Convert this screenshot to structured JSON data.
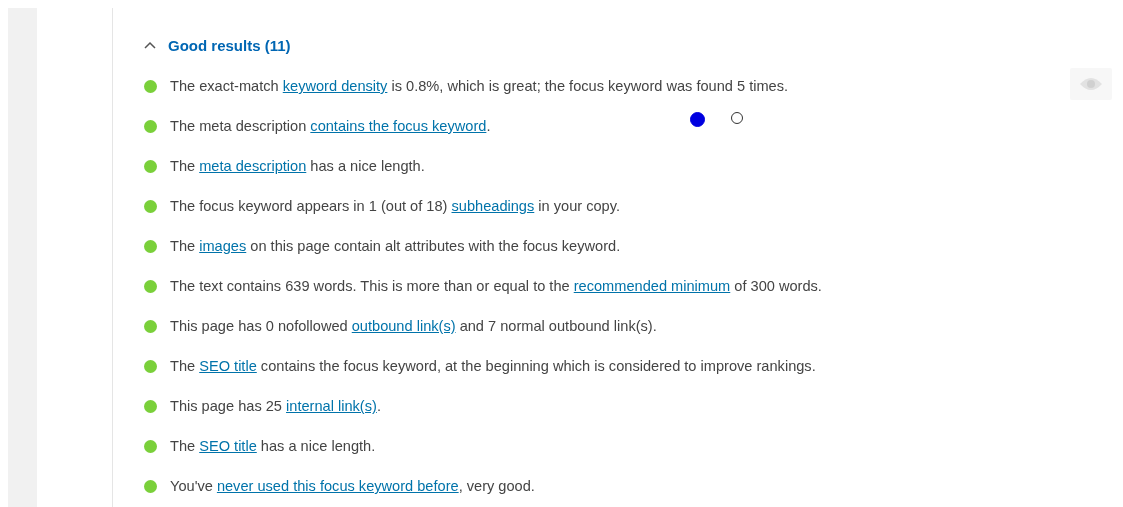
{
  "section": {
    "title": "Good results (11)",
    "expanded": true
  },
  "results": [
    {
      "color": "#7ad03a",
      "before": "The exact-match ",
      "link": "keyword density",
      "after": " is 0.8%, which is great; the focus keyword was found 5 times.",
      "marker_button": true
    },
    {
      "color": "#7ad03a",
      "before": "The meta description ",
      "link": "contains the focus keyword",
      "after": "."
    },
    {
      "color": "#7ad03a",
      "before": "The ",
      "link": "meta description",
      "after": " has a nice length."
    },
    {
      "color": "#7ad03a",
      "before": "The focus keyword appears in 1 (out of 18) ",
      "link": "subheadings",
      "after": " in your copy."
    },
    {
      "color": "#7ad03a",
      "before": "The ",
      "link": "images",
      "after": " on this page contain alt attributes with the focus keyword."
    },
    {
      "color": "#7ad03a",
      "before": "The text contains 639 words. This is more than or equal to the ",
      "link": "recommended minimum",
      "after": " of 300 words."
    },
    {
      "color": "#7ad03a",
      "before": "This page has 0 nofollowed ",
      "link": "outbound link(s)",
      "after": " and 7 normal outbound link(s)."
    },
    {
      "color": "#7ad03a",
      "before": "The ",
      "link": "SEO title",
      "after": " contains the focus keyword, at the beginning which is considered to improve rankings."
    },
    {
      "color": "#7ad03a",
      "before": "This page has 25 ",
      "link": "internal link(s)",
      "after": "."
    },
    {
      "color": "#7ad03a",
      "before": "The ",
      "link": "SEO title",
      "after": " has a nice length."
    },
    {
      "color": "#7ad03a",
      "before": "You've ",
      "link": "never used this focus keyword before",
      "after": ", very good."
    }
  ],
  "pager_dots": [
    {
      "selected": true
    },
    {
      "selected": false
    }
  ]
}
